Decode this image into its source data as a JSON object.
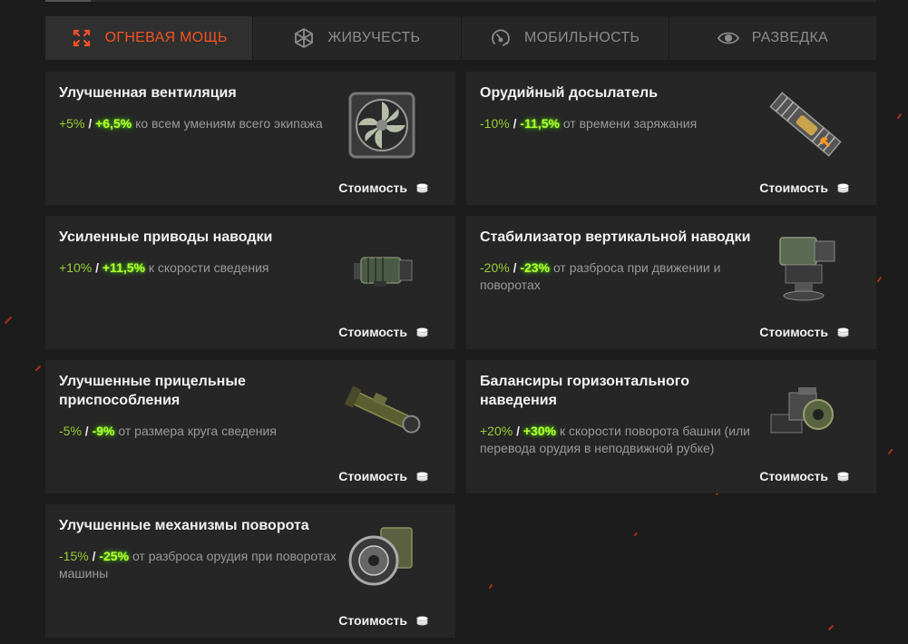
{
  "tabs": [
    {
      "label": "ОГНЕВАЯ МОЩЬ",
      "icon": "crosshair-icon",
      "active": true
    },
    {
      "label": "ЖИВУЧЕСТЬ",
      "icon": "armor-icon",
      "active": false
    },
    {
      "label": "МОБИЛЬНОСТЬ",
      "icon": "speedometer-icon",
      "active": false
    },
    {
      "label": "РАЗВЕДКА",
      "icon": "eye-icon",
      "active": false
    }
  ],
  "colors": {
    "accent": "#f25322",
    "value_green": "#9acd32",
    "value_bright": "#b4ff30",
    "card_bg": "#262626"
  },
  "cards": [
    {
      "title": "Улучшенная вентиляция",
      "v1": "+5%",
      "sep": "/",
      "v2": "+6,5%",
      "text": "ко всем умениям всего экипажа",
      "cost": "Стоимость",
      "image": "ventilation-fan-image"
    },
    {
      "title": "Орудийный досылатель",
      "v1": "-10%",
      "sep": "/",
      "v2": "-11,5%",
      "text": "от времени заряжания",
      "cost": "Стоимость",
      "image": "gun-rammer-image"
    },
    {
      "title": "Усиленные приводы наводки",
      "v1": "+10%",
      "sep": "/",
      "v2": "+11,5%",
      "text": "к скорости сведения",
      "cost": "Стоимость",
      "image": "aiming-drive-motor-image"
    },
    {
      "title": "Стабилизатор вертикальной наводки",
      "v1": "-20%",
      "sep": "/",
      "v2": "-23%",
      "text": "от разброса при движении и поворотах",
      "cost": "Стоимость",
      "image": "stabilizer-image"
    },
    {
      "title": "Улучшенные прицельные приспособления",
      "v1": "-5%",
      "sep": "/",
      "v2": "-9%",
      "text": "от размера круга сведения",
      "cost": "Стоимость",
      "image": "gun-sight-image"
    },
    {
      "title": "Балансиры горизонтального наведения",
      "v1": "+20%",
      "sep": "/",
      "v2": "+30%",
      "text": "к скорости поворота башни (или перевода орудия в неподвижной рубке)",
      "cost": "Стоимость",
      "image": "turret-balancer-image"
    },
    {
      "title": "Улучшенные механизмы поворота",
      "v1": "-15%",
      "sep": "/",
      "v2": "-25%",
      "text": "от разброса орудия при поворотах машины",
      "cost": "Стоимость",
      "image": "rotation-mechanism-image"
    }
  ]
}
